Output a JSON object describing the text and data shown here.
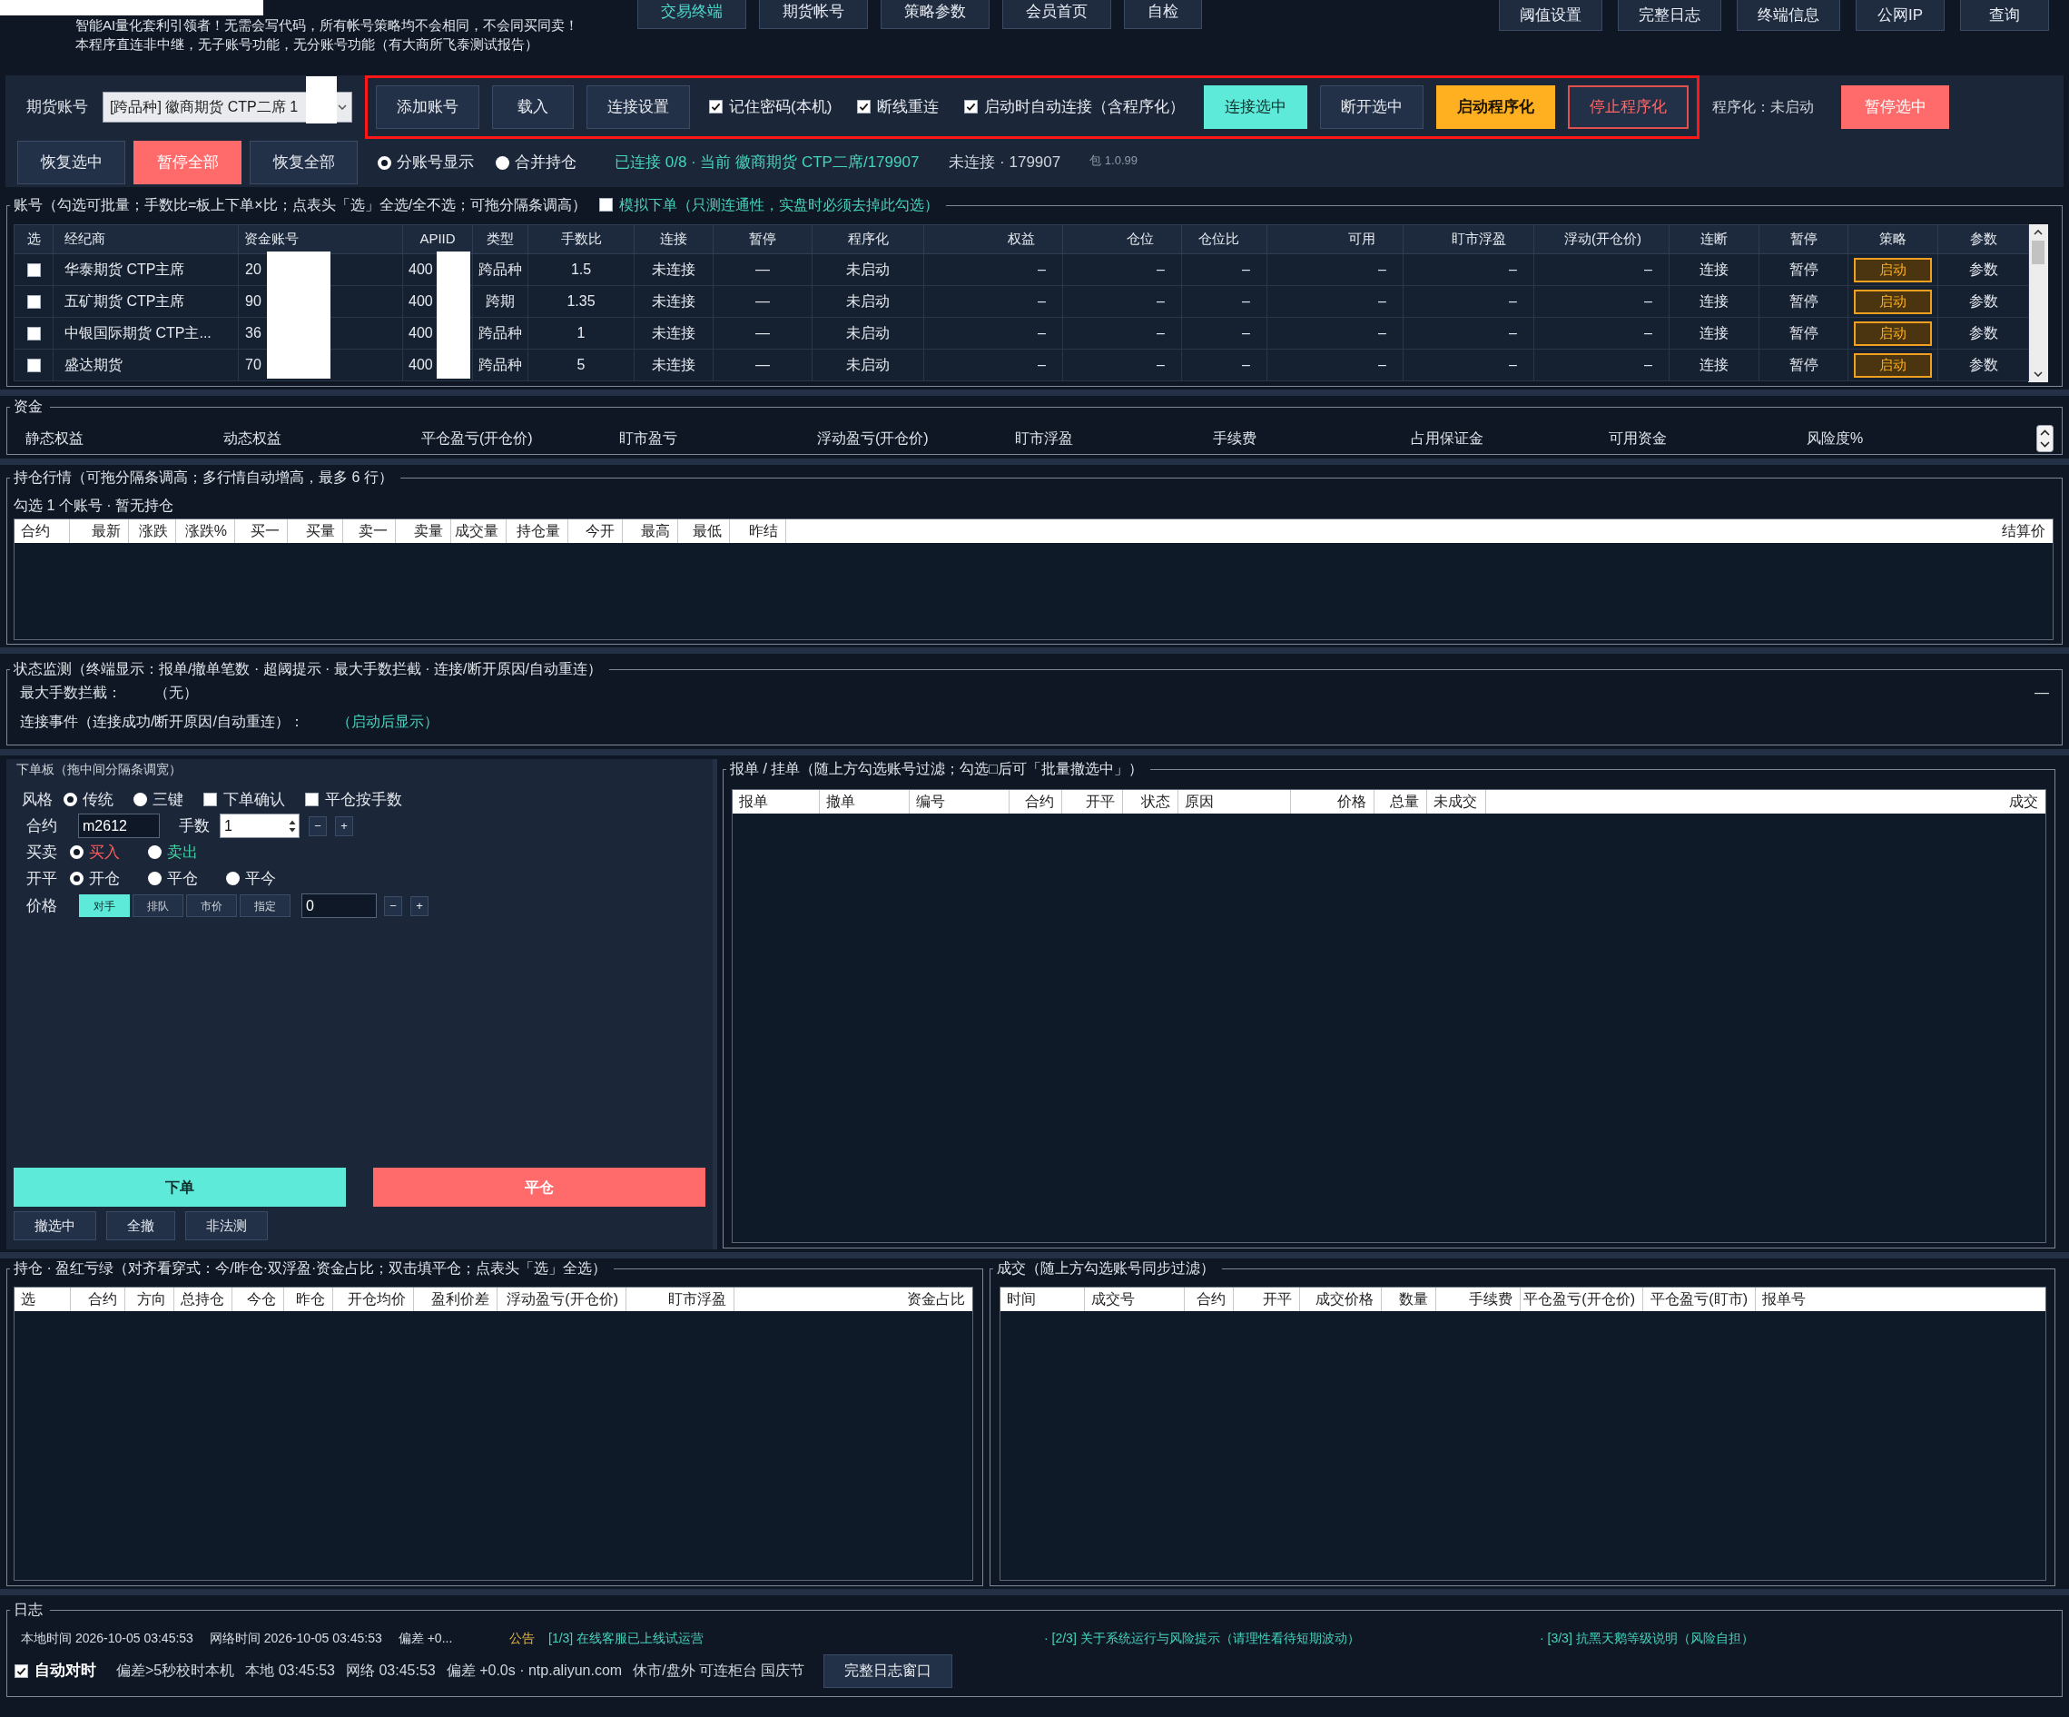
{
  "header": {
    "intro_lines": [
      "智能AI量化套利引领者！无需会写代码，所有帐号策略均不会相同，不会同买同卖！",
      "本程序直连非中继，无子账号功能，无分账号功能（有大商所飞泰测试报告）"
    ],
    "nav_tabs": [
      {
        "label": "交易终端",
        "selected": true
      },
      {
        "label": "期货帐号",
        "selected": false
      },
      {
        "label": "策略参数",
        "selected": false
      },
      {
        "label": "会员首页",
        "selected": false
      },
      {
        "label": "自检",
        "selected": false
      }
    ],
    "utility_buttons": [
      "阈值设置",
      "完整日志",
      "终端信息",
      "公网IP",
      "查询"
    ]
  },
  "toolbar": {
    "account_label": "期货账号",
    "account_select": {
      "value": "[跨品种] 徽商期货 CTP二席 1"
    },
    "highlighted_controls": [
      {
        "kind": "button",
        "label": "添加账号"
      },
      {
        "kind": "button",
        "label": "载入"
      },
      {
        "kind": "button",
        "label": "连接设置"
      },
      {
        "kind": "checkbox",
        "label": "记住密码(本机)",
        "checked": true
      },
      {
        "kind": "checkbox",
        "label": "断线重连",
        "checked": true
      },
      {
        "kind": "checkbox",
        "label": "启动时自动连接（含程序化）",
        "checked": true
      },
      {
        "kind": "accent_button",
        "label": "连接选中"
      },
      {
        "kind": "button",
        "label": "断开选中"
      },
      {
        "kind": "primary_button",
        "label": "启动程序化"
      },
      {
        "kind": "danger_outline_button",
        "label": "停止程序化"
      }
    ],
    "program_status": "程序化：未启动",
    "pause_selected_button": {
      "label": "暂停选中",
      "kind": "danger_button"
    },
    "row2_buttons": [
      {
        "label": "恢复选中",
        "kind": "button"
      },
      {
        "label": "暂停全部",
        "kind": "danger_button"
      },
      {
        "label": "恢复全部",
        "kind": "button"
      }
    ],
    "view_options": [
      {
        "label": "分账号显示",
        "selected": true
      },
      {
        "label": "合并持仓",
        "selected": false
      }
    ],
    "connection_status": "已连接 0/8 · 当前 徽商期货 CTP二席/179907",
    "disconnected_status": "未连接 · 179907",
    "version": "包 1.0.99"
  },
  "accounts": {
    "title": "账号（勾选可批量；手数比=板上下单×比；点表头「选」全选/全不选；可拖分隔条调高）",
    "simulate_order": {
      "label": "模拟下单（只测连通性，实盘时必须去掉此勾选）",
      "checked": false
    },
    "select_header": "选",
    "columns": [
      {
        "label": "经纪商",
        "kind": "text"
      },
      {
        "label": "资金账号",
        "kind": "text"
      },
      {
        "label": "APIID",
        "kind": "text"
      },
      {
        "label": "类型",
        "kind": "text"
      },
      {
        "label": "手数比",
        "kind": "text"
      },
      {
        "label": "连接",
        "kind": "text"
      },
      {
        "label": "暂停",
        "kind": "text"
      },
      {
        "label": "程序化",
        "kind": "text"
      },
      {
        "label": "权益",
        "kind": "text"
      },
      {
        "label": "仓位",
        "kind": "text"
      },
      {
        "label": "仓位比",
        "kind": "text"
      },
      {
        "label": "可用",
        "kind": "text"
      },
      {
        "label": "盯市浮盈",
        "kind": "text"
      },
      {
        "label": "浮动(开仓价)",
        "kind": "text"
      },
      {
        "label": "连断",
        "kind": "link"
      },
      {
        "label": "暂停",
        "kind": "link"
      },
      {
        "label": "策略",
        "kind": "button"
      },
      {
        "label": "参数",
        "kind": "link"
      }
    ],
    "rows": [
      {
        "checked": false,
        "cells": [
          "华泰期货 CTP主席",
          "20",
          "400",
          "跨品种",
          "1.5",
          "未连接",
          "—",
          "未启动",
          "–",
          "–",
          "–",
          "–",
          "–",
          "–",
          "连接",
          "暂停",
          "启动",
          "参数"
        ]
      },
      {
        "checked": false,
        "cells": [
          "五矿期货 CTP主席",
          "90",
          "400",
          "跨期",
          "1.35",
          "未连接",
          "—",
          "未启动",
          "–",
          "–",
          "–",
          "–",
          "–",
          "–",
          "连接",
          "暂停",
          "启动",
          "参数"
        ]
      },
      {
        "checked": false,
        "cells": [
          "中银国际期货 CTP主...",
          "36",
          "400",
          "跨品种",
          "1",
          "未连接",
          "—",
          "未启动",
          "–",
          "–",
          "–",
          "–",
          "–",
          "–",
          "连接",
          "暂停",
          "启动",
          "参数"
        ]
      },
      {
        "checked": false,
        "cells": [
          "盛达期货",
          "70",
          "400",
          "跨品种",
          "5",
          "未连接",
          "—",
          "未启动",
          "–",
          "–",
          "–",
          "–",
          "–",
          "–",
          "连接",
          "暂停",
          "启动",
          "参数"
        ]
      }
    ]
  },
  "funds": {
    "title": "资金",
    "fields": [
      "静态权益",
      "动态权益",
      "平仓盈亏(开仓价)",
      "盯市盈亏",
      "浮动盈亏(开仓价)",
      "盯市浮盈",
      "手续费",
      "占用保证金",
      "可用资金",
      "风险度%"
    ]
  },
  "market": {
    "title": "持仓行情（可拖分隔条调高；多行情自动增高，最多 6 行）",
    "summary": "勾选 1 个账号 · 暂无持仓",
    "columns": [
      "合约",
      "最新",
      "涨跌",
      "涨跌%",
      "买一",
      "买量",
      "卖一",
      "卖量",
      "成交量",
      "持仓量",
      "今开",
      "最高",
      "最低",
      "昨结",
      "结算价"
    ]
  },
  "status": {
    "title": "状态监测（终端显示：报单/撤单笔数 · 超阈提示 · 最大手数拦截 · 连接/断开原因/自动重连）",
    "lines": [
      {
        "label": "最大手数拦截：",
        "value": "（无）",
        "kind": "plain"
      },
      {
        "label": "连接事件（连接成功/断开原因/自动重连）：",
        "value": "（启动后显示）",
        "kind": "highlight"
      }
    ],
    "collapse_button": "—"
  },
  "order_board": {
    "title": "下单板（拖中间分隔条调宽）",
    "style_row": {
      "label": "风格",
      "options": [
        {
          "label": "传统",
          "selected": true
        },
        {
          "label": "三键",
          "selected": false
        }
      ],
      "toggles": [
        {
          "label": "下单确认",
          "checked": false
        },
        {
          "label": "平仓按手数",
          "checked": false
        }
      ]
    },
    "contract": {
      "label": "合约",
      "value": "m2612"
    },
    "quantity": {
      "label": "手数",
      "value": "1",
      "steppers": [
        "−",
        "+"
      ]
    },
    "side_row": {
      "label": "买卖",
      "options": [
        {
          "label": "买入",
          "selected": true,
          "color": "#ff5b5b"
        },
        {
          "label": "卖出",
          "selected": false,
          "color": "#3fd6a4"
        }
      ]
    },
    "open_close_row": {
      "label": "开平",
      "options": [
        {
          "label": "开仓",
          "selected": true
        },
        {
          "label": "平仓",
          "selected": false
        },
        {
          "label": "平今",
          "selected": false
        }
      ]
    },
    "price_row": {
      "label": "价格",
      "modes": [
        {
          "label": "对手",
          "selected": true
        },
        {
          "label": "排队",
          "selected": false
        },
        {
          "label": "市价",
          "selected": false
        },
        {
          "label": "指定",
          "selected": false
        }
      ],
      "value": "0",
      "steppers": [
        "−",
        "+"
      ]
    },
    "actions": [
      {
        "label": "下单",
        "kind": "accent_button"
      },
      {
        "label": "平仓",
        "kind": "danger_button"
      }
    ],
    "cancel_buttons": [
      "撤选中",
      "全撤",
      "非法测"
    ]
  },
  "orders": {
    "title": "报单 / 挂单（随上方勾选账号过滤；勾选□后可「批量撤选中」）",
    "columns": [
      "报单",
      "撤单",
      "编号",
      "合约",
      "开平",
      "状态",
      "原因",
      "价格",
      "总量",
      "未成交",
      "成交"
    ]
  },
  "positions": {
    "title": "持仓 · 盈红亏绿（对齐看穿式：今/昨仓·双浮盈·资金占比；双击填平仓；点表头「选」全选）",
    "columns": [
      "选",
      "合约",
      "方向",
      "总持仓",
      "今仓",
      "昨仓",
      "开仓均价",
      "盈利价差",
      "浮动盈亏(开仓价)",
      "盯市浮盈",
      "资金占比"
    ]
  },
  "trades": {
    "title": "成交（随上方勾选账号同步过滤）",
    "columns": [
      "时间",
      "成交号",
      "合约",
      "开平",
      "成交价格",
      "数量",
      "手续费",
      "平仓盈亏(开仓价)",
      "平仓盈亏(盯市)",
      "报单号"
    ]
  },
  "log": {
    "title": "日志",
    "time_segments": [
      "本地时间 2026-10-05 03:45:53",
      "网络时间 2026-10-05 03:45:53",
      "偏差 +0..."
    ],
    "notice_label": "公告",
    "notices": [
      "[1/3] 在线客服已上线试运营",
      "· [2/3] 关于系统运行与风险提示（请理性看待短期波动）",
      "· [3/3] 抗黑天鹅等级说明（风险自担）"
    ],
    "auto_sync": {
      "label": "自动对时",
      "checked": true
    },
    "status_items": [
      "偏差>5秒校时本机",
      "本地 03:45:53",
      "网络 03:45:53",
      "偏差 +0.0s · ntp.aliyun.com",
      "休市/盘外 可连柜台 国庆节"
    ],
    "full_log_button": "完整日志窗口"
  }
}
